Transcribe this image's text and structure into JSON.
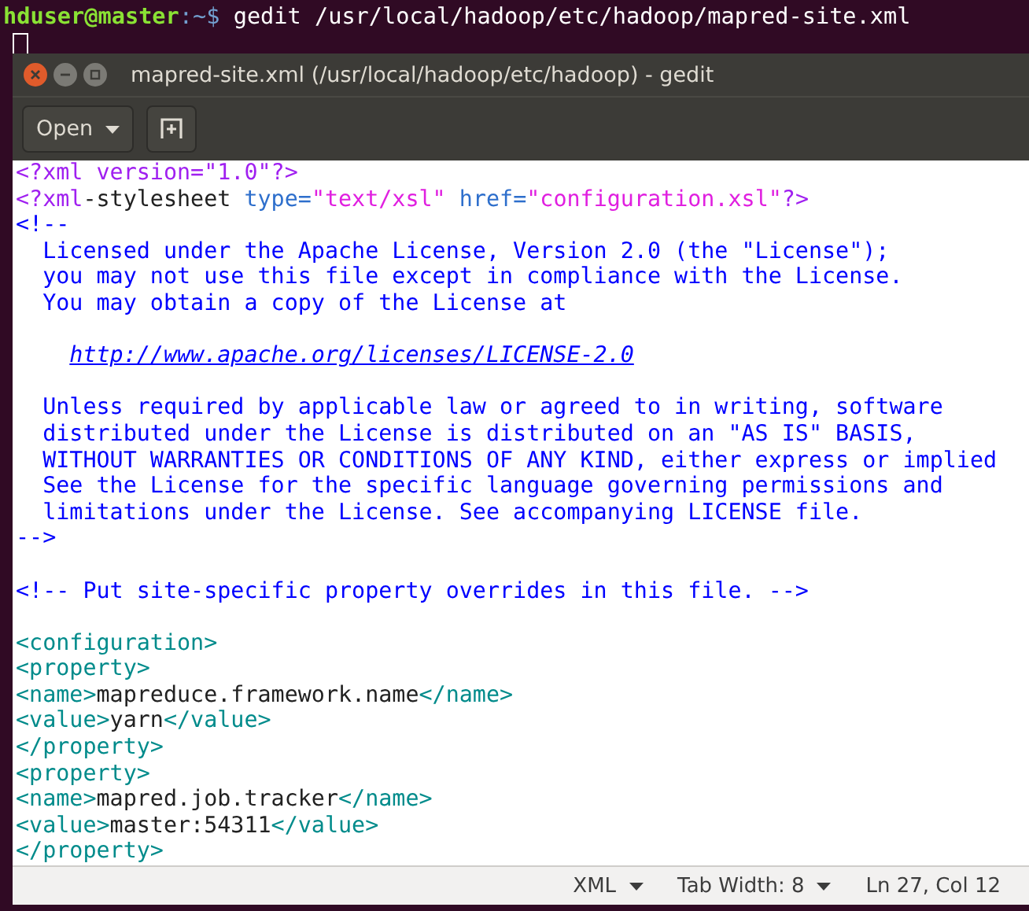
{
  "terminal": {
    "prompt_user": "hduser@master",
    "prompt_path": ":~$",
    "command": " gedit /usr/local/hadoop/etc/hadoop/mapred-site.xml"
  },
  "window": {
    "title": "mapred-site.xml (/usr/local/hadoop/etc/hadoop) - gedit"
  },
  "toolbar": {
    "open_button": "Open"
  },
  "editor": {
    "lines": [
      {
        "kind": "code",
        "segments": [
          {
            "kind": "pi",
            "text": "<?xml version=\"1.0\"?>"
          }
        ]
      },
      {
        "kind": "code",
        "segments": [
          {
            "kind": "pi",
            "text": "<?xml"
          },
          {
            "kind": "text",
            "text": "-stylesheet "
          },
          {
            "kind": "attr",
            "text": "type="
          },
          {
            "kind": "string",
            "text": "\"text/xsl\" "
          },
          {
            "kind": "attr",
            "text": "href="
          },
          {
            "kind": "string",
            "text": "\"configuration.xsl\""
          },
          {
            "kind": "pi",
            "text": "?>"
          }
        ]
      },
      {
        "kind": "code",
        "segments": [
          {
            "kind": "comment",
            "text": "<!--"
          }
        ]
      },
      {
        "kind": "code",
        "segments": [
          {
            "kind": "comment",
            "text": "  Licensed under the Apache License, Version 2.0 (the \"License\");"
          }
        ]
      },
      {
        "kind": "code",
        "segments": [
          {
            "kind": "comment",
            "text": "  you may not use this file except in compliance with the License."
          }
        ]
      },
      {
        "kind": "code",
        "segments": [
          {
            "kind": "comment",
            "text": "  You may obtain a copy of the License at"
          }
        ]
      },
      {
        "kind": "blank"
      },
      {
        "kind": "code",
        "indented": true,
        "segments": [
          {
            "kind": "link",
            "text": "http://www.apache.org/licenses/LICENSE-2.0"
          }
        ]
      },
      {
        "kind": "blank"
      },
      {
        "kind": "code",
        "segments": [
          {
            "kind": "comment",
            "text": "  Unless required by applicable law or agreed to in writing, software"
          }
        ]
      },
      {
        "kind": "code",
        "segments": [
          {
            "kind": "comment",
            "text": "  distributed under the License is distributed on an \"AS IS\" BASIS,"
          }
        ]
      },
      {
        "kind": "code",
        "segments": [
          {
            "kind": "comment",
            "text": "  WITHOUT WARRANTIES OR CONDITIONS OF ANY KIND, either express or implied"
          }
        ]
      },
      {
        "kind": "code",
        "segments": [
          {
            "kind": "comment",
            "text": "  See the License for the specific language governing permissions and"
          }
        ]
      },
      {
        "kind": "code",
        "segments": [
          {
            "kind": "comment",
            "text": "  limitations under the License. See accompanying LICENSE file."
          }
        ]
      },
      {
        "kind": "code",
        "segments": [
          {
            "kind": "comment",
            "text": "-->"
          }
        ]
      },
      {
        "kind": "blank"
      },
      {
        "kind": "code",
        "segments": [
          {
            "kind": "comment",
            "text": "<!-- Put site-specific property overrides in this file. -->"
          }
        ]
      },
      {
        "kind": "blank"
      },
      {
        "kind": "code",
        "segments": [
          {
            "kind": "tag",
            "text": "<configuration>"
          }
        ]
      },
      {
        "kind": "code",
        "segments": [
          {
            "kind": "tag",
            "text": "<property>"
          }
        ]
      },
      {
        "kind": "code",
        "segments": [
          {
            "kind": "tag",
            "text": "<name>"
          },
          {
            "kind": "text",
            "text": "mapreduce.framework.name"
          },
          {
            "kind": "tag",
            "text": "</name>"
          }
        ]
      },
      {
        "kind": "code",
        "segments": [
          {
            "kind": "tag",
            "text": "<value>"
          },
          {
            "kind": "text",
            "text": "yarn"
          },
          {
            "kind": "tag",
            "text": "</value>"
          }
        ]
      },
      {
        "kind": "code",
        "segments": [
          {
            "kind": "tag",
            "text": "</property>"
          }
        ]
      },
      {
        "kind": "code",
        "segments": [
          {
            "kind": "tag",
            "text": "<property>"
          }
        ]
      },
      {
        "kind": "code",
        "segments": [
          {
            "kind": "tag",
            "text": "<name>"
          },
          {
            "kind": "text",
            "text": "mapred.job.tracker"
          },
          {
            "kind": "tag",
            "text": "</name>"
          }
        ]
      },
      {
        "kind": "code",
        "segments": [
          {
            "kind": "tag",
            "text": "<value>"
          },
          {
            "kind": "text",
            "text": "master:54311"
          },
          {
            "kind": "tag",
            "text": "</value>"
          }
        ]
      },
      {
        "kind": "code",
        "segments": [
          {
            "kind": "tag",
            "text": "</property>"
          }
        ]
      }
    ]
  },
  "status_bar": {
    "language": "XML",
    "tab_width": "Tab Width: 8",
    "position": "Ln 27, Col 12"
  }
}
